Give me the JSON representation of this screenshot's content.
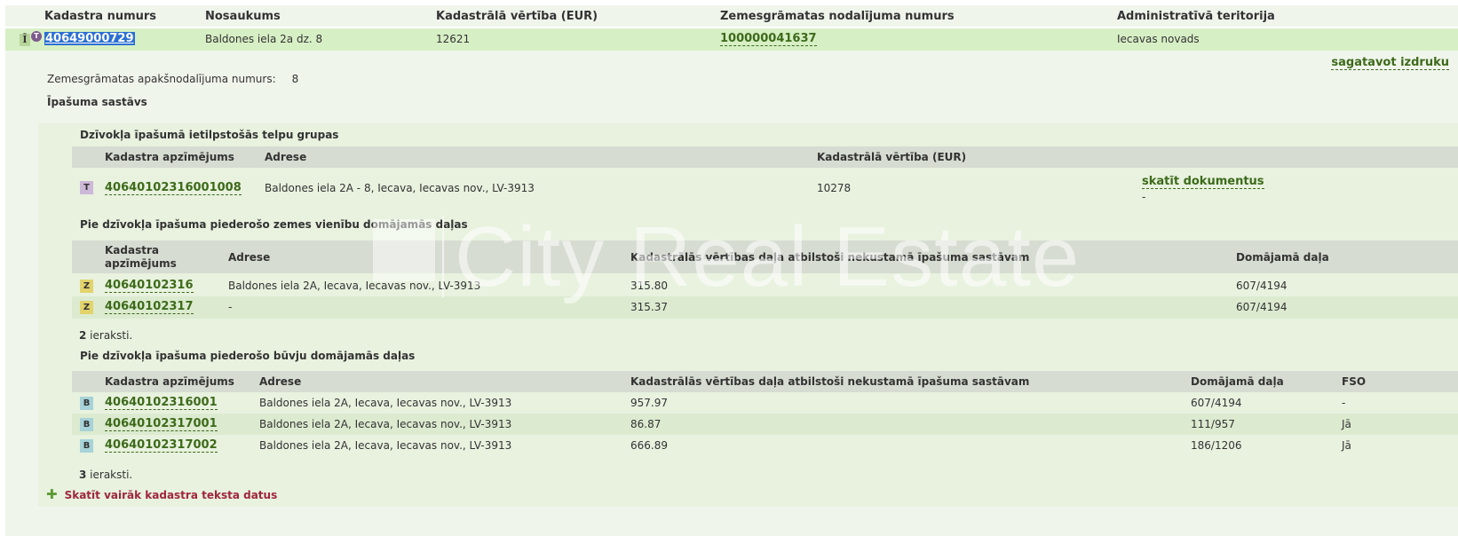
{
  "header": {
    "col_cadastre": "Kadastra numurs",
    "col_name": "Nosaukums",
    "col_value": "Kadastrālā vērtība (EUR)",
    "col_landbook": "Zemesgrāmatas nodalījuma numurs",
    "col_territory": "Administratīvā teritorija"
  },
  "main_row": {
    "icon_letter": "Ī",
    "icon_badge": "T",
    "cadastre": "40649000729",
    "name": "Baldones iela 2a dz. 8",
    "value": "12621",
    "landbook": "100000041637",
    "territory": "Iecavas novads"
  },
  "print_link": "sagatavot izdruku",
  "subsection": {
    "label": "Zemesgrāmatas apakšnodalījuma numurs:",
    "value": "8"
  },
  "composition_title": "Īpašuma sastāvs",
  "rooms": {
    "title": "Dzīvokļa īpašumā ietilpstošās telpu grupas",
    "headers": [
      "Kadastra apzīmējums",
      "Adrese",
      "Kadastrālā vērtība (EUR)"
    ],
    "rows": [
      {
        "badge": "T",
        "code": "40640102316001008",
        "address": "Baldones iela 2A - 8, Iecava, Iecavas nov., LV-3913",
        "value": "10278",
        "doc_link": "skatīt dokumentus",
        "doc_extra": "-"
      }
    ]
  },
  "land": {
    "title": "Pie dzīvokļa īpašuma piederošo zemes vienību domājamās daļas",
    "headers": [
      "Kadastra apzīmējums",
      "Adrese",
      "Kadastrālās vērtības daļa atbilstoši nekustamā īpašuma sastāvam",
      "Domājamā daļa"
    ],
    "rows": [
      {
        "badge": "Z",
        "code": "40640102316",
        "address": "Baldones iela 2A, Iecava, Iecavas nov., LV-3913",
        "value": "315.80",
        "share": "607/4194"
      },
      {
        "badge": "Z",
        "code": "40640102317",
        "address": "-",
        "value": "315.37",
        "share": "607/4194"
      }
    ],
    "count_num": "2",
    "count_label": " ieraksti."
  },
  "buildings": {
    "title": "Pie dzīvokļa īpašuma piederošo būvju domājamās daļas",
    "headers": [
      "Kadastra apzīmējums",
      "Adrese",
      "Kadastrālās vērtības daļa atbilstoši nekustamā īpašuma sastāvam",
      "Domājamā daļa",
      "FSO"
    ],
    "rows": [
      {
        "badge": "B",
        "code": "40640102316001",
        "address": "Baldones iela 2A, Iecava, Iecavas nov., LV-3913",
        "value": "957.97",
        "share": "607/4194",
        "fso": "-"
      },
      {
        "badge": "B",
        "code": "40640102317001",
        "address": "Baldones iela 2A, Iecava, Iecavas nov., LV-3913",
        "value": "86.87",
        "share": "111/957",
        "fso": "Jā"
      },
      {
        "badge": "B",
        "code": "40640102317002",
        "address": "Baldones iela 2A, Iecava, Iecavas nov., LV-3913",
        "value": "666.89",
        "share": "186/1206",
        "fso": "Jā"
      }
    ],
    "count_num": "3",
    "count_label": " ieraksti."
  },
  "more_link": "Skatīt vairāk kadastra teksta datus",
  "watermark": "City Real Estate",
  "colors": {
    "link_green": "#3d6a1a",
    "more_red": "#a0263b",
    "row_highlight": "#d7efc5",
    "selection_blue": "#2b6fd1"
  }
}
